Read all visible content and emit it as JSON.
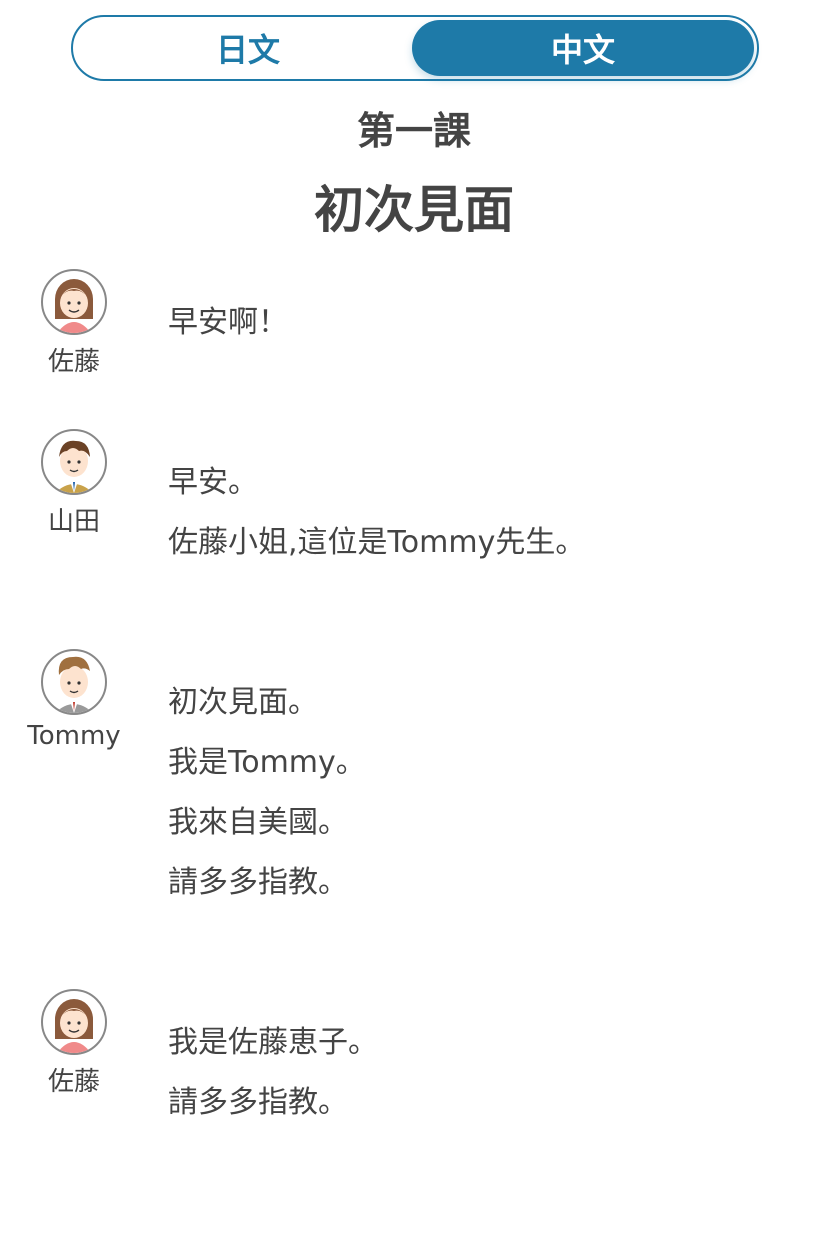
{
  "toggle": {
    "japanese": "日文",
    "chinese": "中文",
    "selected": "中文",
    "accent": "#1e7aa8"
  },
  "lesson": {
    "number": "第一課",
    "title": "初次見面"
  },
  "dialogue": [
    {
      "speaker": "佐藤",
      "avatar": "woman-icon",
      "lines": [
        "早安啊！"
      ]
    },
    {
      "speaker": "山田",
      "avatar": "man-suit-icon",
      "lines": [
        "早安。",
        "佐藤小姐,這位是Tommy先生。"
      ]
    },
    {
      "speaker": "Tommy",
      "avatar": "man-quiff-icon",
      "lines": [
        "初次見面。",
        "我是Tommy。",
        "我來自美國。",
        "請多多指教。"
      ]
    },
    {
      "speaker": "佐藤",
      "avatar": "woman-icon",
      "lines": [
        "我是佐藤恵子。",
        "請多多指教。"
      ]
    }
  ]
}
